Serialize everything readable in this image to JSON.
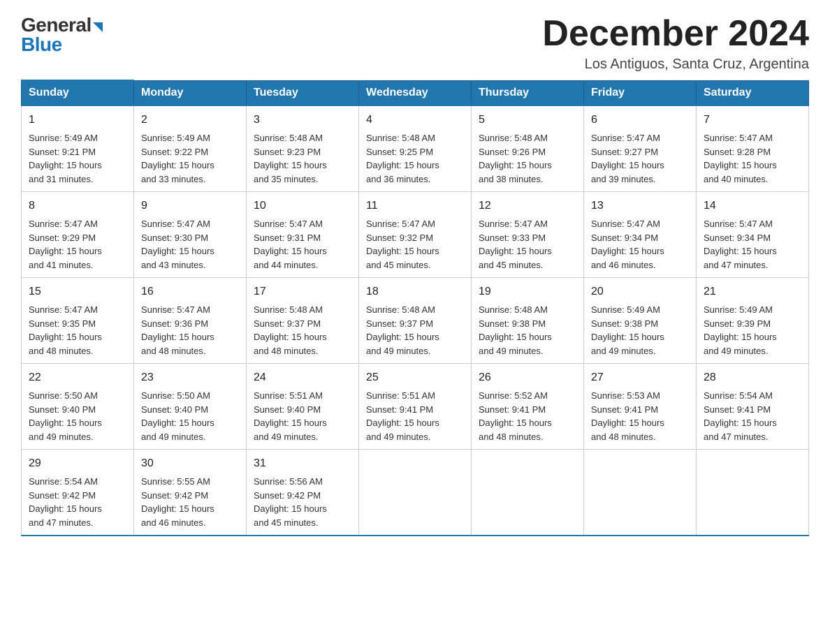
{
  "header": {
    "logo_general": "General",
    "logo_blue": "Blue",
    "month_title": "December 2024",
    "location": "Los Antiguos, Santa Cruz, Argentina"
  },
  "weekdays": [
    "Sunday",
    "Monday",
    "Tuesday",
    "Wednesday",
    "Thursday",
    "Friday",
    "Saturday"
  ],
  "weeks": [
    [
      {
        "day": "1",
        "sunrise": "5:49 AM",
        "sunset": "9:21 PM",
        "daylight": "15 hours and 31 minutes."
      },
      {
        "day": "2",
        "sunrise": "5:49 AM",
        "sunset": "9:22 PM",
        "daylight": "15 hours and 33 minutes."
      },
      {
        "day": "3",
        "sunrise": "5:48 AM",
        "sunset": "9:23 PM",
        "daylight": "15 hours and 35 minutes."
      },
      {
        "day": "4",
        "sunrise": "5:48 AM",
        "sunset": "9:25 PM",
        "daylight": "15 hours and 36 minutes."
      },
      {
        "day": "5",
        "sunrise": "5:48 AM",
        "sunset": "9:26 PM",
        "daylight": "15 hours and 38 minutes."
      },
      {
        "day": "6",
        "sunrise": "5:47 AM",
        "sunset": "9:27 PM",
        "daylight": "15 hours and 39 minutes."
      },
      {
        "day": "7",
        "sunrise": "5:47 AM",
        "sunset": "9:28 PM",
        "daylight": "15 hours and 40 minutes."
      }
    ],
    [
      {
        "day": "8",
        "sunrise": "5:47 AM",
        "sunset": "9:29 PM",
        "daylight": "15 hours and 41 minutes."
      },
      {
        "day": "9",
        "sunrise": "5:47 AM",
        "sunset": "9:30 PM",
        "daylight": "15 hours and 43 minutes."
      },
      {
        "day": "10",
        "sunrise": "5:47 AM",
        "sunset": "9:31 PM",
        "daylight": "15 hours and 44 minutes."
      },
      {
        "day": "11",
        "sunrise": "5:47 AM",
        "sunset": "9:32 PM",
        "daylight": "15 hours and 45 minutes."
      },
      {
        "day": "12",
        "sunrise": "5:47 AM",
        "sunset": "9:33 PM",
        "daylight": "15 hours and 45 minutes."
      },
      {
        "day": "13",
        "sunrise": "5:47 AM",
        "sunset": "9:34 PM",
        "daylight": "15 hours and 46 minutes."
      },
      {
        "day": "14",
        "sunrise": "5:47 AM",
        "sunset": "9:34 PM",
        "daylight": "15 hours and 47 minutes."
      }
    ],
    [
      {
        "day": "15",
        "sunrise": "5:47 AM",
        "sunset": "9:35 PM",
        "daylight": "15 hours and 48 minutes."
      },
      {
        "day": "16",
        "sunrise": "5:47 AM",
        "sunset": "9:36 PM",
        "daylight": "15 hours and 48 minutes."
      },
      {
        "day": "17",
        "sunrise": "5:48 AM",
        "sunset": "9:37 PM",
        "daylight": "15 hours and 48 minutes."
      },
      {
        "day": "18",
        "sunrise": "5:48 AM",
        "sunset": "9:37 PM",
        "daylight": "15 hours and 49 minutes."
      },
      {
        "day": "19",
        "sunrise": "5:48 AM",
        "sunset": "9:38 PM",
        "daylight": "15 hours and 49 minutes."
      },
      {
        "day": "20",
        "sunrise": "5:49 AM",
        "sunset": "9:38 PM",
        "daylight": "15 hours and 49 minutes."
      },
      {
        "day": "21",
        "sunrise": "5:49 AM",
        "sunset": "9:39 PM",
        "daylight": "15 hours and 49 minutes."
      }
    ],
    [
      {
        "day": "22",
        "sunrise": "5:50 AM",
        "sunset": "9:40 PM",
        "daylight": "15 hours and 49 minutes."
      },
      {
        "day": "23",
        "sunrise": "5:50 AM",
        "sunset": "9:40 PM",
        "daylight": "15 hours and 49 minutes."
      },
      {
        "day": "24",
        "sunrise": "5:51 AM",
        "sunset": "9:40 PM",
        "daylight": "15 hours and 49 minutes."
      },
      {
        "day": "25",
        "sunrise": "5:51 AM",
        "sunset": "9:41 PM",
        "daylight": "15 hours and 49 minutes."
      },
      {
        "day": "26",
        "sunrise": "5:52 AM",
        "sunset": "9:41 PM",
        "daylight": "15 hours and 48 minutes."
      },
      {
        "day": "27",
        "sunrise": "5:53 AM",
        "sunset": "9:41 PM",
        "daylight": "15 hours and 48 minutes."
      },
      {
        "day": "28",
        "sunrise": "5:54 AM",
        "sunset": "9:41 PM",
        "daylight": "15 hours and 47 minutes."
      }
    ],
    [
      {
        "day": "29",
        "sunrise": "5:54 AM",
        "sunset": "9:42 PM",
        "daylight": "15 hours and 47 minutes."
      },
      {
        "day": "30",
        "sunrise": "5:55 AM",
        "sunset": "9:42 PM",
        "daylight": "15 hours and 46 minutes."
      },
      {
        "day": "31",
        "sunrise": "5:56 AM",
        "sunset": "9:42 PM",
        "daylight": "15 hours and 45 minutes."
      },
      null,
      null,
      null,
      null
    ]
  ],
  "labels": {
    "sunrise": "Sunrise:",
    "sunset": "Sunset:",
    "daylight": "Daylight:"
  }
}
